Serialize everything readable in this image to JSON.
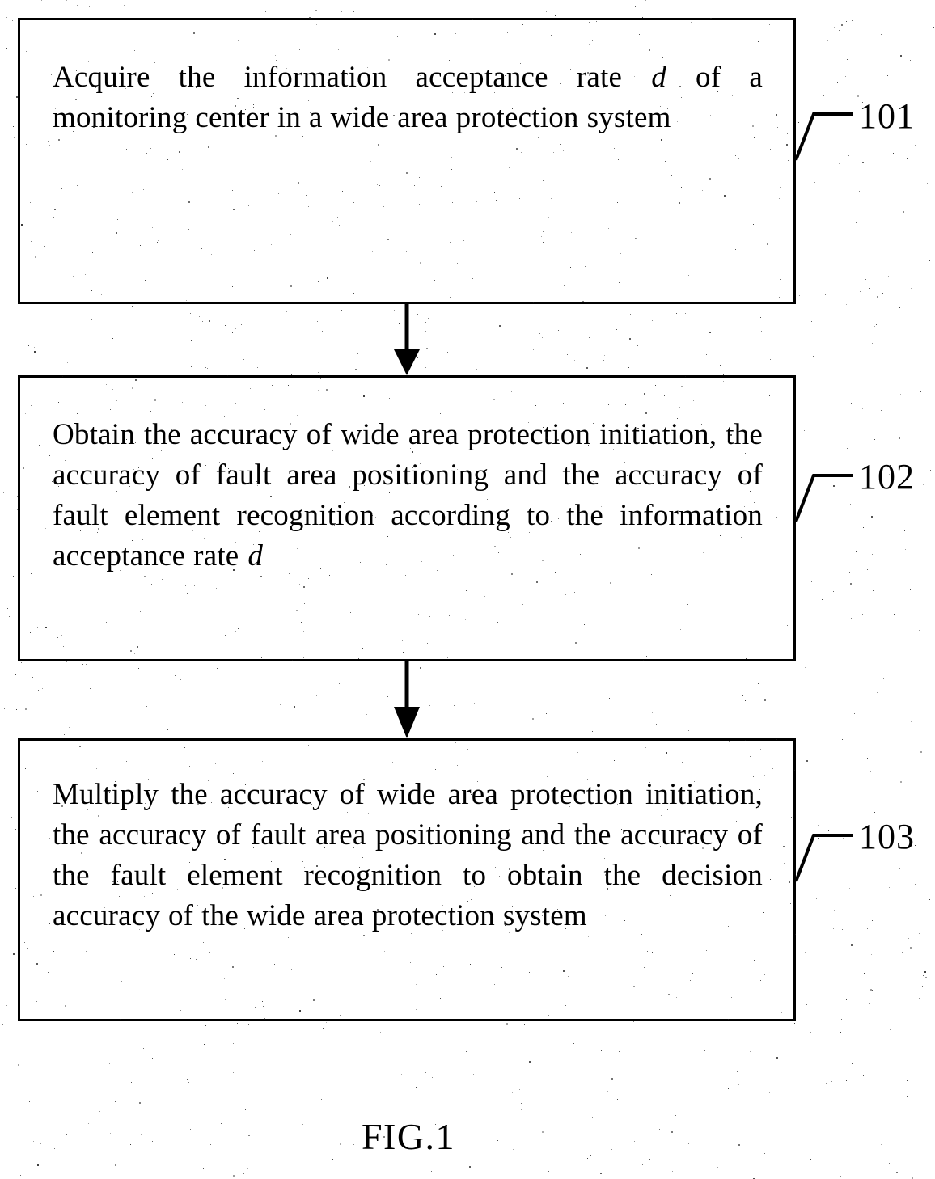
{
  "figure": {
    "caption": "FIG.1",
    "boxes": [
      {
        "id": "101",
        "ref": "101",
        "text_before_var": "Acquire the information acceptance rate ",
        "var": "d",
        "text_after_var": " of a monitoring center in a wide area protection system",
        "full_text": "Acquire the information acceptance rate d of a monitoring center in a wide area protection system"
      },
      {
        "id": "102",
        "ref": "102",
        "text_before_var": "Obtain the accuracy of wide area protection initiation, the accuracy of fault area positioning and the accuracy of fault element recognition according to the information acceptance rate ",
        "var": "d",
        "text_after_var": "",
        "full_text": "Obtain the accuracy of wide area protection initiation, the accuracy of fault area positioning and the accuracy of fault element recognition according to the information acceptance rate d"
      },
      {
        "id": "103",
        "ref": "103",
        "text_before_var": "Multiply the accuracy of wide area protection initiation, the accuracy of fault area positioning and the accuracy of the fault element recognition to obtain the decision accuracy of the wide area protection system",
        "var": "",
        "text_after_var": "",
        "full_text": "Multiply the accuracy of wide area protection initiation, the accuracy of fault area positioning and the accuracy of the fault element recognition to obtain the decision accuracy of the wide area protection system"
      }
    ],
    "connectors": [
      {
        "name": "arrow-101-to-102",
        "from": "101",
        "to": "102",
        "style": "solid-filled-arrowhead"
      },
      {
        "name": "arrow-102-to-103",
        "from": "102",
        "to": "103",
        "style": "solid-filled-arrowhead"
      }
    ],
    "colors": {
      "ink": "#000000",
      "paper": "#ffffff"
    }
  }
}
